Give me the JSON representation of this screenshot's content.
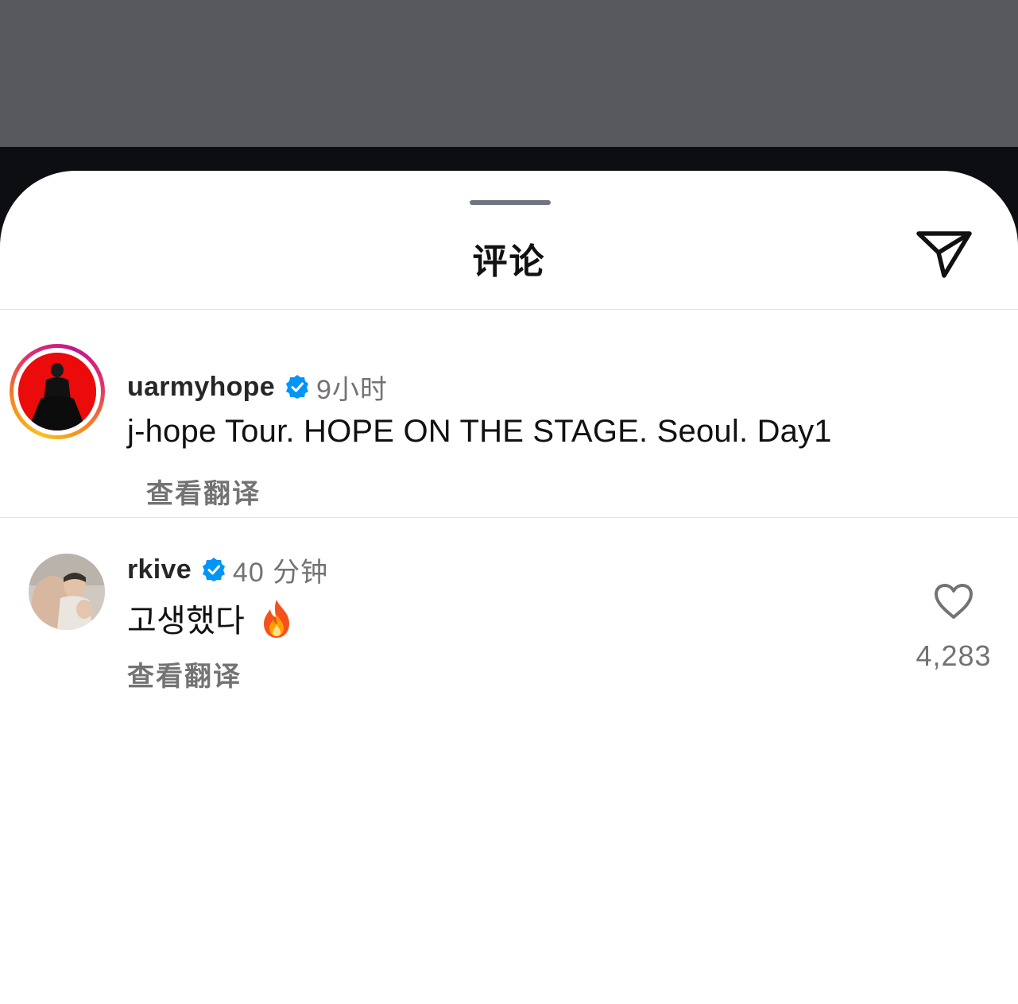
{
  "sheet": {
    "title": "评论",
    "send_icon": "send-icon",
    "grabber_icon": "drag-handle"
  },
  "comments": [
    {
      "username": "uarmyhope",
      "verified": true,
      "time": "9小时",
      "text": "j-hope Tour. HOPE ON THE STAGE. Seoul. Day1",
      "translate_label": "查看翻译",
      "avatar": "story-ring-avatar"
    },
    {
      "username": "rkive",
      "verified": true,
      "time": "40 分钟",
      "text": "고생했다",
      "emoji": "fire-emoji",
      "translate_label": "查看翻译",
      "likes": "4,283",
      "like_icon": "heart-icon",
      "avatar": "photo-avatar"
    }
  ],
  "colors": {
    "backdrop": "#58595d",
    "verified_blue": "#0095f6",
    "secondary_text": "#737373",
    "primary_text": "#111111"
  }
}
